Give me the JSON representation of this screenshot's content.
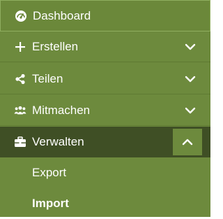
{
  "menu": {
    "items": [
      {
        "label": "Dashboard",
        "icon": "dashboard-gauge-icon"
      },
      {
        "label": "Erstellen",
        "icon": "plus-icon",
        "chevron": "chevron-down-icon"
      },
      {
        "label": "Teilen",
        "icon": "share-icon",
        "chevron": "chevron-down-icon"
      },
      {
        "label": "Mitmachen",
        "icon": "users-icon",
        "chevron": "chevron-down-icon"
      },
      {
        "label": "Verwalten",
        "icon": "briefcase-icon",
        "chevron": "chevron-up-icon",
        "expanded": true
      }
    ],
    "submenu": [
      {
        "label": "Export"
      },
      {
        "label": "Import",
        "active": true
      }
    ]
  },
  "colors": {
    "menu_bg": "#6d8a3d",
    "active_bg": "#3f4f25",
    "text": "#ffffff"
  }
}
